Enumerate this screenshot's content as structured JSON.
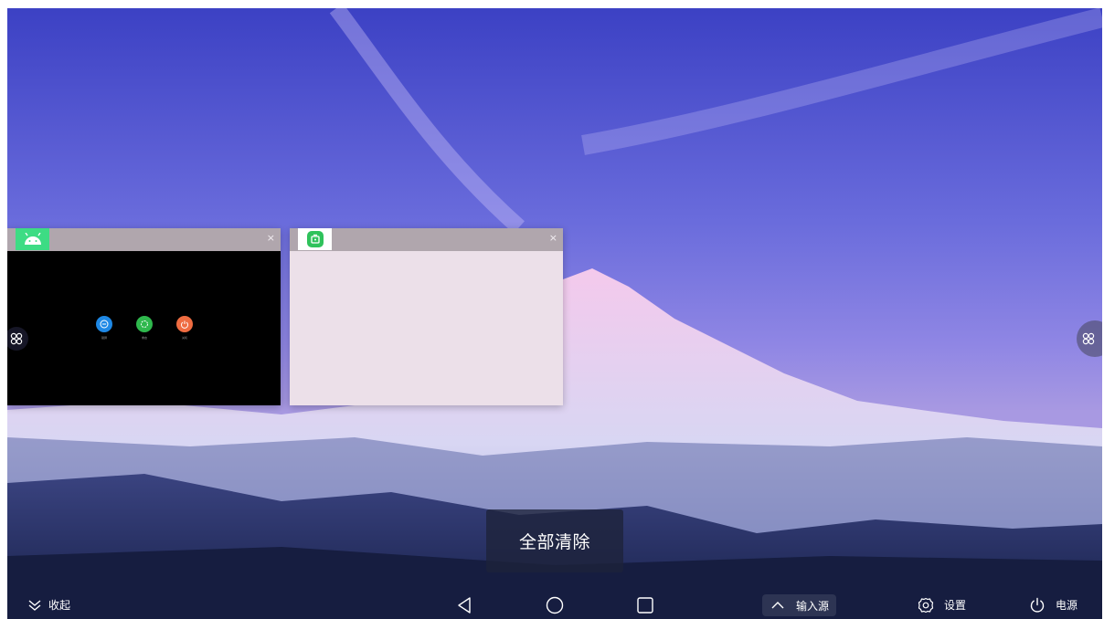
{
  "recent_apps": {
    "cards": [
      {
        "app_icon": "android-icon",
        "icon_color": "#3ddc84",
        "close_glyph": "×",
        "content": {
          "buttons": [
            {
              "icon": "minus-circle-icon",
              "color": "#1e88e5",
              "label": "锁屏"
            },
            {
              "icon": "restart-icon",
              "color": "#2fb84d",
              "label": "重启"
            },
            {
              "icon": "power-icon",
              "color": "#ef6c41",
              "label": "关机"
            }
          ]
        }
      },
      {
        "app_icon": "green-app-icon",
        "icon_color": "#2fc25b",
        "close_glyph": "×",
        "content": {}
      }
    ]
  },
  "clear_all_label": "全部清除",
  "edge_handles": {
    "left_icon": "apps-grid-icon",
    "right_icon": "apps-grid-icon"
  },
  "navbar": {
    "collapse": {
      "icon": "double-chevron-down-icon",
      "label": "收起"
    },
    "back_icon": "back-triangle-icon",
    "home_icon": "home-circle-icon",
    "recents_icon": "recents-square-icon",
    "input_source": {
      "icon": "chevron-up-icon",
      "label": "输入源"
    },
    "settings": {
      "icon": "gear-icon",
      "label": "设置"
    },
    "power": {
      "icon": "power-icon",
      "label": "电源"
    }
  }
}
